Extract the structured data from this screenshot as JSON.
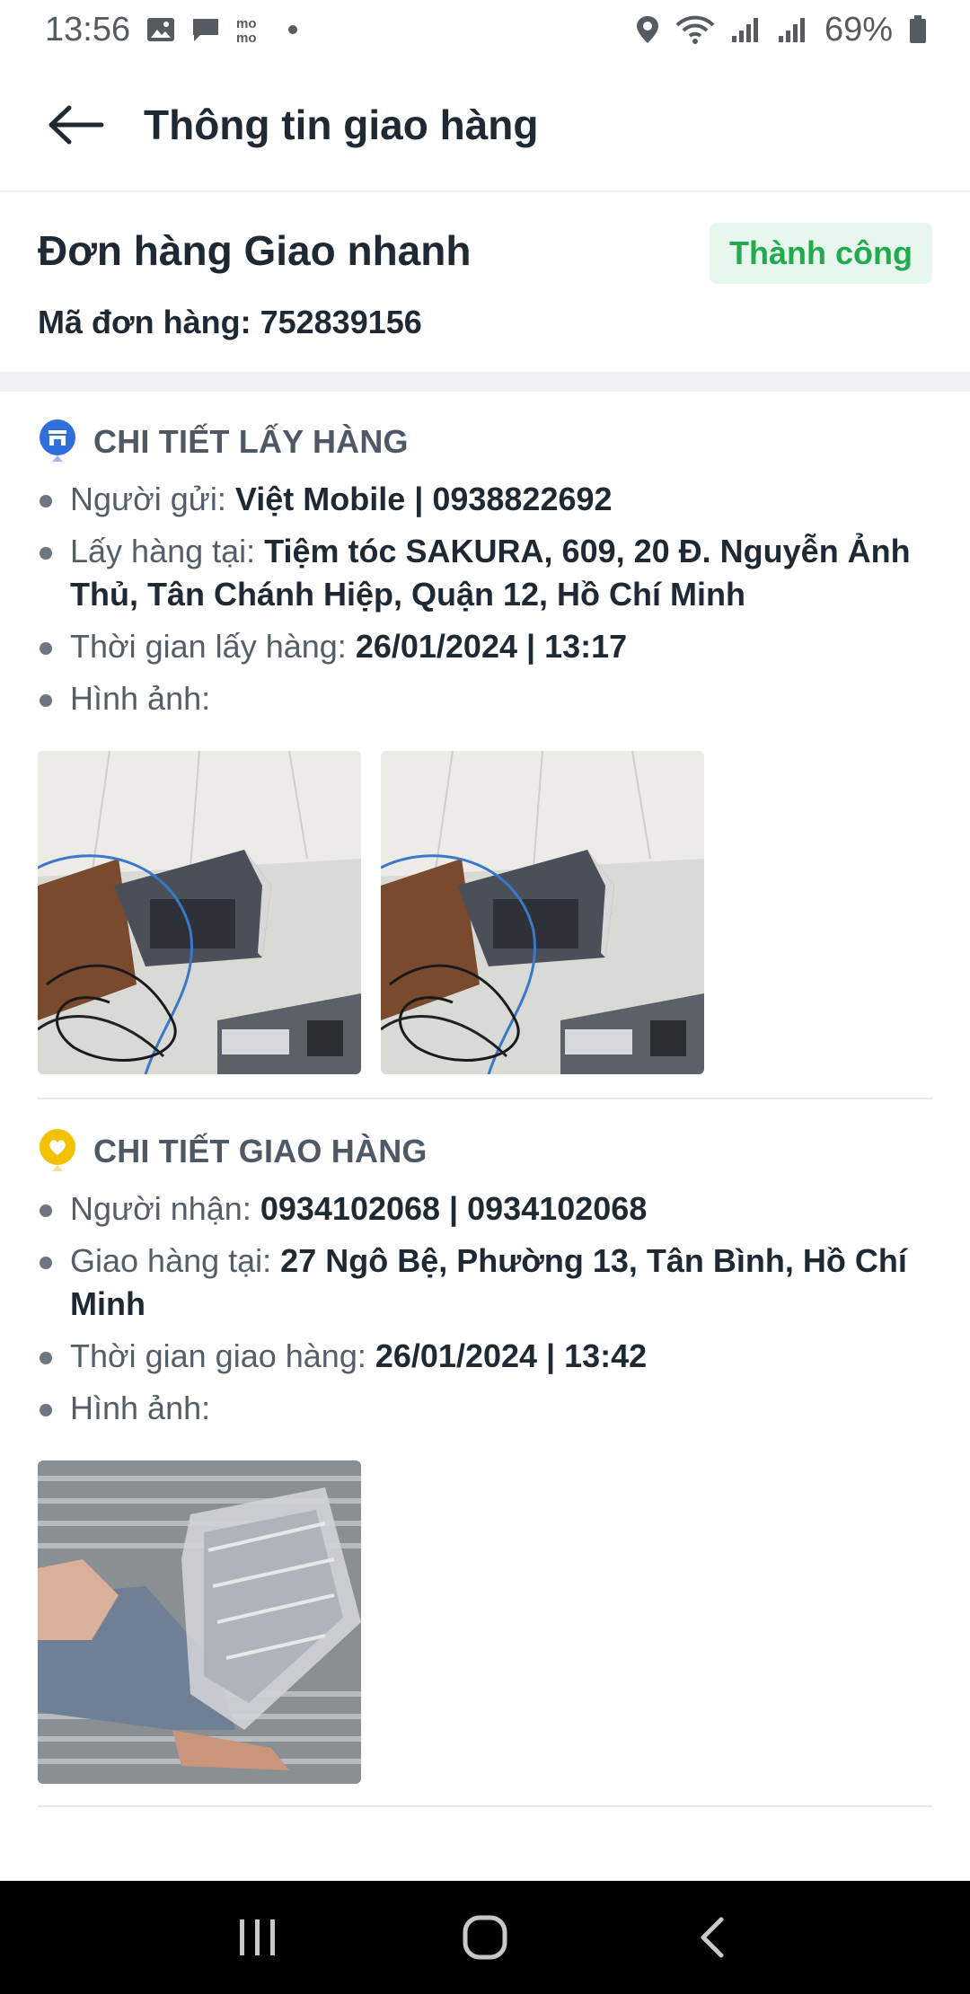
{
  "status_bar": {
    "time": "13:56",
    "battery": "69%",
    "icons_left": [
      "image-icon",
      "message-icon",
      "mo-icon"
    ],
    "icons_right": [
      "location-icon",
      "wifi-icon",
      "signal-icon",
      "signal-icon",
      "battery-icon"
    ]
  },
  "app_bar": {
    "title": "Thông tin giao hàng"
  },
  "order": {
    "type": "Đơn hàng Giao nhanh",
    "status": "Thành công",
    "code_label": "Mã đơn hàng:",
    "code": "752839156"
  },
  "pickup": {
    "title": "CHI TIẾT LẤY HÀNG",
    "sender_label": "Người gửi:",
    "sender": "Việt Mobile | 0938822692",
    "location_label": "Lấy hàng tại:",
    "location": "Tiệm tóc SAKURA, 609, 20 Đ. Nguyễn Ảnh Thủ, Tân Chánh Hiệp, Quận 12, Hồ Chí Minh",
    "time_label": "Thời gian lấy hàng:",
    "time": "26/01/2024 | 13:17",
    "images_label": "Hình ảnh:"
  },
  "delivery": {
    "title": "CHI TIẾT GIAO HÀNG",
    "receiver_label": "Người nhận:",
    "receiver": "0934102068 | 0934102068",
    "location_label": "Giao hàng tại:",
    "location": "27 Ngô Bệ, Phường 13, Tân Bình, Hồ Chí Minh",
    "time_label": "Thời gian giao hàng:",
    "time": "26/01/2024 | 13:42",
    "images_label": "Hình ảnh:"
  },
  "colors": {
    "success_text": "#23a94e",
    "success_bg": "#e8f7ed",
    "pickup_icon": "#2f6fdc",
    "delivery_icon": "#f2c200"
  }
}
